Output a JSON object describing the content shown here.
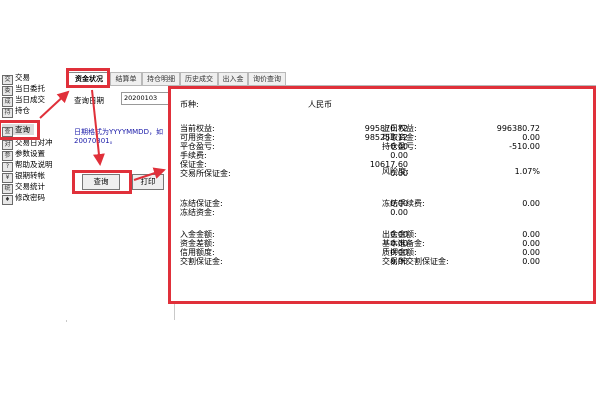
{
  "sidebar": {
    "items": [
      {
        "label": "交易",
        "icon": "trade-icon",
        "active": false
      },
      {
        "label": "当日委托",
        "icon": "order-icon",
        "active": false
      },
      {
        "label": "当日成交",
        "icon": "deal-icon",
        "active": false
      },
      {
        "label": "持仓",
        "icon": "position-icon",
        "active": false
      },
      {
        "label": "查询",
        "icon": "query-icon",
        "active": true
      },
      {
        "label": "交易日对冲",
        "icon": "hedge-icon",
        "active": false
      },
      {
        "label": "参数设置",
        "icon": "settings-icon",
        "active": false
      },
      {
        "label": "帮助及说明",
        "icon": "help-icon",
        "active": false
      },
      {
        "label": "银期转帐",
        "icon": "transfer-icon",
        "active": false
      },
      {
        "label": "交易统计",
        "icon": "stats-icon",
        "active": false
      },
      {
        "label": "修改密码",
        "icon": "key-icon",
        "active": false
      }
    ]
  },
  "tabs": [
    {
      "label": "资金状况",
      "active": true
    },
    {
      "label": "结算单",
      "active": false
    },
    {
      "label": "持仓明细",
      "active": false
    },
    {
      "label": "历史成交",
      "active": false
    },
    {
      "label": "出入金",
      "active": false
    },
    {
      "label": "询价查询",
      "active": false
    }
  ],
  "query": {
    "date_label": "查询日期",
    "date_value": "20200103",
    "hint": "日期格式为YYYYMMDD，如20070301。",
    "query_button": "查询",
    "print_button": "打印"
  },
  "result": {
    "currency_label": "币种:",
    "currency_value": "人民币",
    "left": [
      {
        "label": "当前权益:",
        "value": "995870.72"
      },
      {
        "label": "可用资金:",
        "value": "985253.12"
      },
      {
        "label": "平仓盈亏:",
        "value": "0.00"
      },
      {
        "label": "手续费:",
        "value": "0.00"
      },
      {
        "label": "保证金:",
        "value": "10617.60"
      },
      {
        "label": "交易所保证金:",
        "value": "0.00"
      },
      {
        "label": "冻结保证金:",
        "value": "0.00"
      },
      {
        "label": "冻结资金:",
        "value": "0.00"
      },
      {
        "label": "入金金额:",
        "value": "0.00"
      },
      {
        "label": "资金差额:",
        "value": "0.00"
      },
      {
        "label": "信用额度:",
        "value": "0.00"
      },
      {
        "label": "交割保证金:",
        "value": "0.00"
      }
    ],
    "right": [
      {
        "label": "上日权益:",
        "value": "996380.72"
      },
      {
        "label": "可取资金:",
        "value": "0.00"
      },
      {
        "label": "持仓盈亏:",
        "value": "-510.00"
      },
      {
        "label": "风险度:",
        "value": "1.07%"
      },
      {
        "label": "冻结手续费:",
        "value": "0.00"
      },
      {
        "label": "出金金额:",
        "value": "0.00"
      },
      {
        "label": "基本准备金:",
        "value": "0.00"
      },
      {
        "label": "质押金额:",
        "value": "0.00"
      },
      {
        "label": "交易所交割保证金:",
        "value": "0.00"
      }
    ]
  },
  "colors": {
    "highlight": "#e0303a",
    "hint_text": "#1a1aa8"
  }
}
